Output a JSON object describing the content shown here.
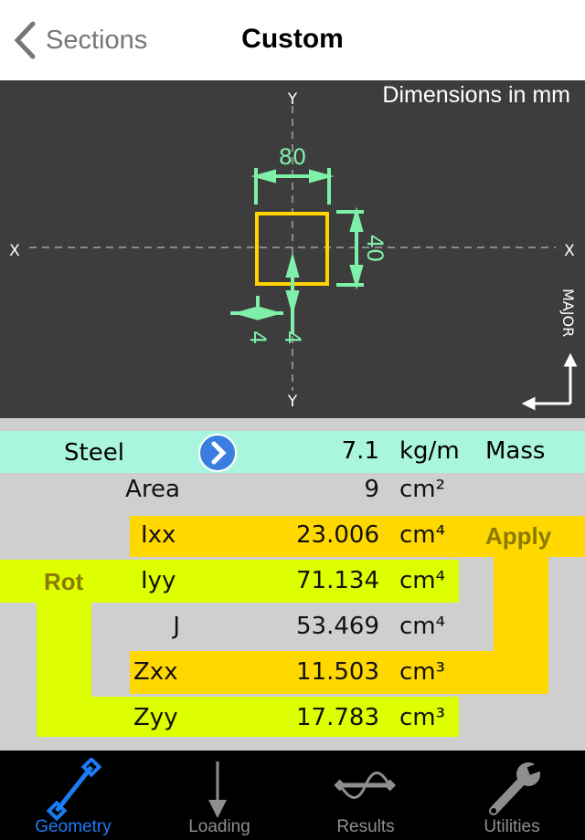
{
  "header": {
    "back_label": "Sections",
    "title": "Custom"
  },
  "drawing": {
    "note": "Dimensions in mm",
    "axis_x": "X",
    "axis_y": "Y",
    "width": "80",
    "height": "40",
    "thickness_left": "4",
    "thickness_bottom": "4",
    "orientation": "MAJOR",
    "shape_color": "#ffd400",
    "dim_color": "#7ef0a8"
  },
  "material": {
    "name": "Steel",
    "value": "7.1",
    "unit": "kg/m",
    "label": "Mass"
  },
  "properties": [
    {
      "label": "Area",
      "value": "9",
      "unit": "cm²"
    },
    {
      "label": "Ixx",
      "value": "23.006",
      "unit": "cm⁴"
    },
    {
      "label": "Iyy",
      "value": "71.134",
      "unit": "cm⁴"
    },
    {
      "label": "J",
      "value": "53.469",
      "unit": "cm⁴"
    },
    {
      "label": "Zxx",
      "value": "11.503",
      "unit": "cm³"
    },
    {
      "label": "Zyy",
      "value": "17.783",
      "unit": "cm³"
    }
  ],
  "buttons": {
    "apply": "Apply",
    "rot": "Rot"
  },
  "colors": {
    "apply_band": "#ffd800",
    "rot_band": "#ddff00",
    "mass_row": "#aaf5dd",
    "active_tab": "#1a7cf5"
  },
  "tabs": [
    {
      "label": "Geometry",
      "icon": "member-icon",
      "active": true
    },
    {
      "label": "Loading",
      "icon": "arrow-down-icon",
      "active": false
    },
    {
      "label": "Results",
      "icon": "deflection-icon",
      "active": false
    },
    {
      "label": "Utilities",
      "icon": "wrench-icon",
      "active": false
    }
  ]
}
